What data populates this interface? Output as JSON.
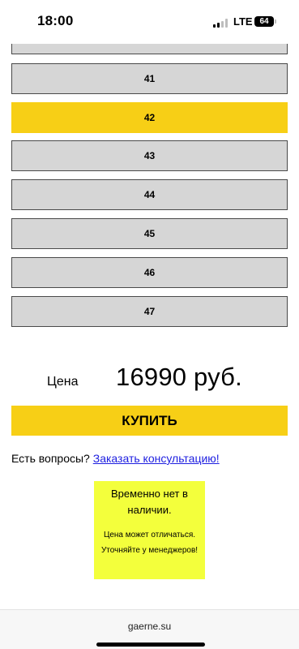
{
  "status_bar": {
    "time": "18:00",
    "network": "LTE",
    "battery": "64"
  },
  "sizes": {
    "partial_label": "",
    "items": [
      {
        "label": "41",
        "selected": false
      },
      {
        "label": "42",
        "selected": true
      },
      {
        "label": "43",
        "selected": false
      },
      {
        "label": "44",
        "selected": false
      },
      {
        "label": "45",
        "selected": false
      },
      {
        "label": "46",
        "selected": false
      },
      {
        "label": "47",
        "selected": false
      }
    ]
  },
  "price": {
    "label": "Цена",
    "value": "16990 руб."
  },
  "buy_button": {
    "label": "КУПИТЬ"
  },
  "questions": {
    "text": "Есть вопросы?",
    "link": "Заказать консультацию!"
  },
  "notice": {
    "title": "Временно нет в наличии.",
    "note": "Цена может отличаться. Уточняйте у менеджеров!"
  },
  "browser": {
    "url": "gaerne.su"
  },
  "colors": {
    "accent_yellow": "#f7cf16",
    "notice_yellow": "#f3ff3c",
    "option_gray": "#d6d6d6",
    "link_blue": "#1d1ee0"
  }
}
